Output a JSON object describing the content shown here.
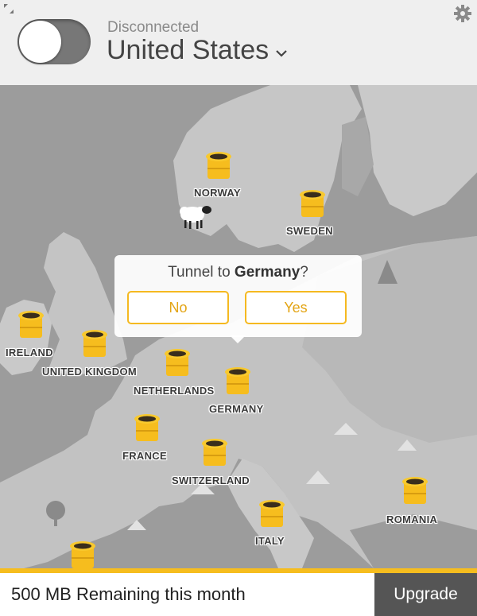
{
  "header": {
    "status": "Disconnected",
    "country": "United States"
  },
  "map": {
    "locations": [
      {
        "label": "NORWAY"
      },
      {
        "label": "SWEDEN"
      },
      {
        "label": "IRELAND"
      },
      {
        "label": "UNITED KINGDOM"
      },
      {
        "label": "NETHERLANDS"
      },
      {
        "label": "GERMANY"
      },
      {
        "label": "FRANCE"
      },
      {
        "label": "SWITZERLAND"
      },
      {
        "label": "ROMANIA"
      },
      {
        "label": "ITALY"
      }
    ]
  },
  "dialog": {
    "prefix": "Tunnel to ",
    "country": "Germany",
    "suffix": "?",
    "no_label": "No",
    "yes_label": "Yes"
  },
  "footer": {
    "data_amount": "500 MB",
    "remaining_text": " Remaining this month",
    "upgrade_label": "Upgrade"
  },
  "colors": {
    "accent": "#f6bd1e",
    "land": "#c9c9c9",
    "sea": "#9a9a9a",
    "upgrade_bg": "#555555"
  },
  "data_remaining_fraction": 1.0
}
